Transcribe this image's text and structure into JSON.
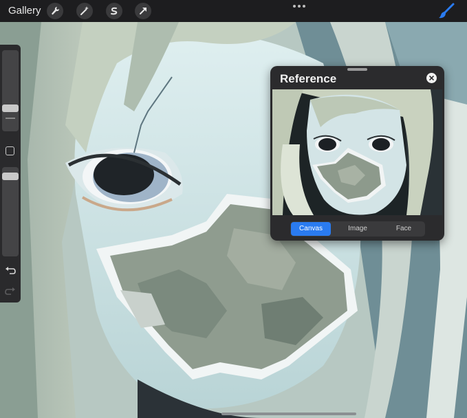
{
  "toolbar": {
    "gallery_label": "Gallery",
    "tools": [
      "wrench-icon",
      "magic-wand-icon",
      "selection-icon",
      "transform-arrow-icon"
    ],
    "more_icon": "ellipsis-icon",
    "brush_icon": "paintbrush-icon",
    "accent_color": "#2a7bf0"
  },
  "sidebar": {
    "brush_size_slider": {
      "value": 0.72
    },
    "opacity_slider": {
      "value": 0.1
    },
    "undo_icon": "undo-icon",
    "redo_icon": "redo-icon"
  },
  "reference": {
    "title": "Reference",
    "close_icon": "close-icon",
    "tabs": [
      {
        "label": "Canvas",
        "active": true
      },
      {
        "label": "Image",
        "active": false
      },
      {
        "label": "Face",
        "active": false
      }
    ]
  }
}
